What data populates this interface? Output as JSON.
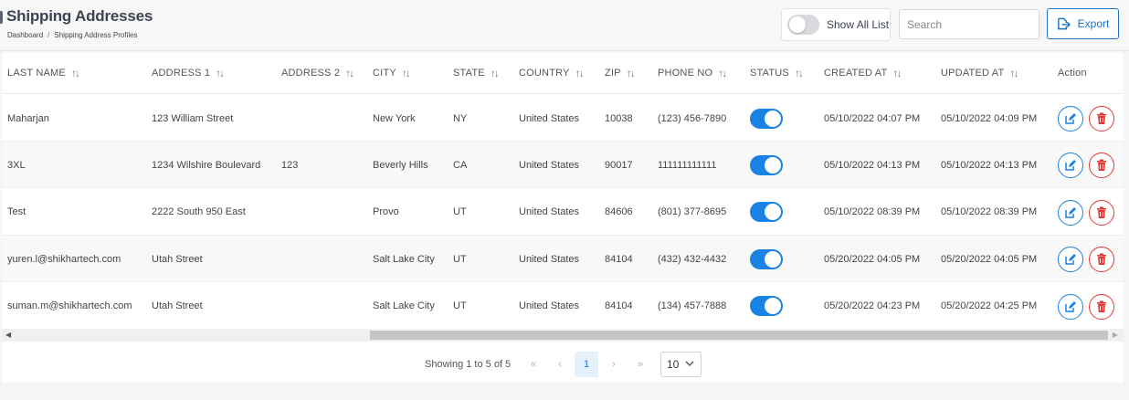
{
  "header": {
    "title": "Shipping Addresses",
    "breadcrumb": [
      "Dashboard",
      "Shipping Address Profiles"
    ],
    "breadcrumb_sep": "/",
    "show_all_label": "Show All List",
    "search_placeholder": "Search",
    "export_label": "Export"
  },
  "table": {
    "columns": [
      "LAST NAME",
      "ADDRESS 1",
      "ADDRESS 2",
      "CITY",
      "STATE",
      "COUNTRY",
      "ZIP",
      "PHONE NO",
      "STATUS",
      "CREATED AT",
      "UPDATED AT",
      "Action"
    ],
    "rows": [
      {
        "last_name": "Maharjan",
        "address1": "123 William Street",
        "address2": "",
        "city": "New York",
        "state": "NY",
        "country": "United States",
        "zip": "10038",
        "phone": "(123) 456-7890",
        "status": true,
        "created": "05/10/2022 04:07 PM",
        "updated": "05/10/2022 04:09 PM"
      },
      {
        "last_name": "3XL",
        "address1": "1234 Wilshire Boulevard",
        "address2": "123",
        "city": "Beverly Hills",
        "state": "CA",
        "country": "United States",
        "zip": "90017",
        "phone": "111111111111",
        "status": true,
        "created": "05/10/2022 04:13 PM",
        "updated": "05/10/2022 04:13 PM"
      },
      {
        "last_name": "Test",
        "address1": "2222 South 950 East",
        "address2": "",
        "city": "Provo",
        "state": "UT",
        "country": "United States",
        "zip": "84606",
        "phone": "(801) 377-8695",
        "status": true,
        "created": "05/10/2022 08:39 PM",
        "updated": "05/10/2022 08:39 PM"
      },
      {
        "last_name": "yuren.l@shikhartech.com",
        "address1": "Utah Street",
        "address2": "",
        "city": "Salt Lake City",
        "state": "UT",
        "country": "United States",
        "zip": "84104",
        "phone": "(432) 432-4432",
        "status": true,
        "created": "05/20/2022 04:05 PM",
        "updated": "05/20/2022 04:05 PM"
      },
      {
        "last_name": "suman.m@shikhartech.com",
        "address1": "Utah Street",
        "address2": "",
        "city": "Salt Lake City",
        "state": "UT",
        "country": "United States",
        "zip": "84104",
        "phone": "(134) 457-7888",
        "status": true,
        "created": "05/20/2022 04:23 PM",
        "updated": "05/20/2022 04:25 PM"
      }
    ]
  },
  "pagination": {
    "showing": "Showing 1 to 5 of 5",
    "first": "«",
    "prev": "‹",
    "current_page": "1",
    "next": "›",
    "last": "»",
    "page_size": "10"
  },
  "colors": {
    "accent": "#1a82e2",
    "danger": "#e53935"
  },
  "icons": {
    "sort": "sort-arrows-icon",
    "edit": "edit-icon",
    "delete": "trash-icon",
    "export": "export-icon"
  }
}
